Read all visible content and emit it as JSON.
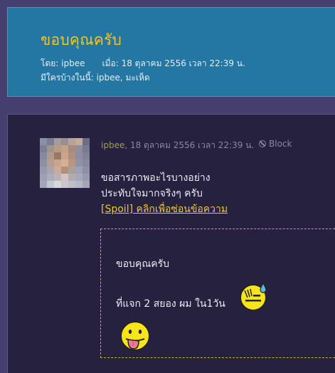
{
  "topic": {
    "title": "ขอบคุณครับ",
    "by_label": "โดย:",
    "author": "ipbee",
    "when_label": "เมื่อ:",
    "date": "18 ตุลาคม 2556 เวลา 22:39 น.",
    "viewers_label": "มีใครบ้างในนี้:",
    "viewers": "ipbee, มะเห็ด"
  },
  "post": {
    "author": "ipbee",
    "date": ", 18 ตุลาคม 2556 เวลา 22:39 น.",
    "block_label": "Block",
    "lines": [
      "ขอสารภาพอะไรบางอย่าง",
      "ประทับใจมากจริงๆ ครับ"
    ],
    "spoiler_link": "[Spoil] คลิกเพื่อซ่อนข้อความ",
    "spoiler": {
      "line1": "ขอบคุณครับ",
      "line2": "ที่แจก 2 สยอง ผม ใน1วัน"
    }
  },
  "icons": {
    "block": "block-icon",
    "emoji1": "sweat-smile-emoji-icon",
    "emoji2": "tongue-out-emoji-icon"
  },
  "colors": {
    "header_bg": "#2577a3",
    "title": "#f3c523",
    "post_bg": "#25213f",
    "page_bg": "#443f6e",
    "link": "#f2c72a"
  }
}
